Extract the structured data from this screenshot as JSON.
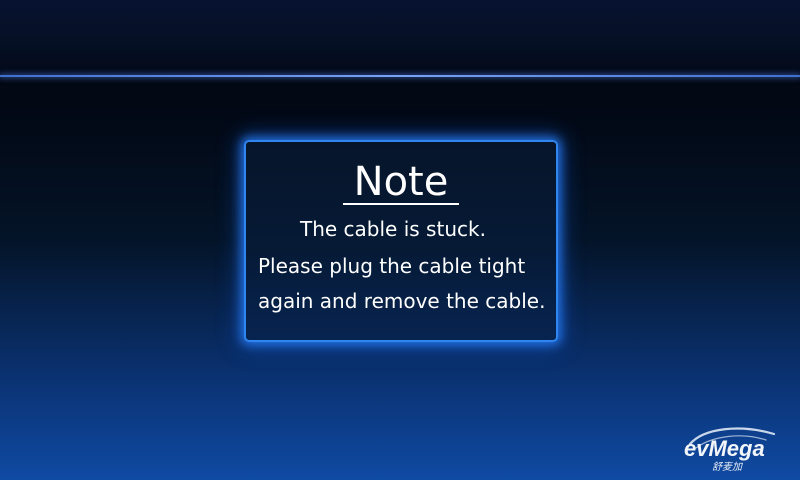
{
  "dialog": {
    "title": "Note",
    "lines": [
      "The cable is stuck.",
      "Please plug the cable tight",
      "again and remove the cable."
    ]
  },
  "watermark": {
    "brand": "evMega",
    "subtitle": "舒麦加"
  },
  "colors": {
    "dialog_border": "#2f86f0",
    "top_line": "#7aa2f5"
  }
}
